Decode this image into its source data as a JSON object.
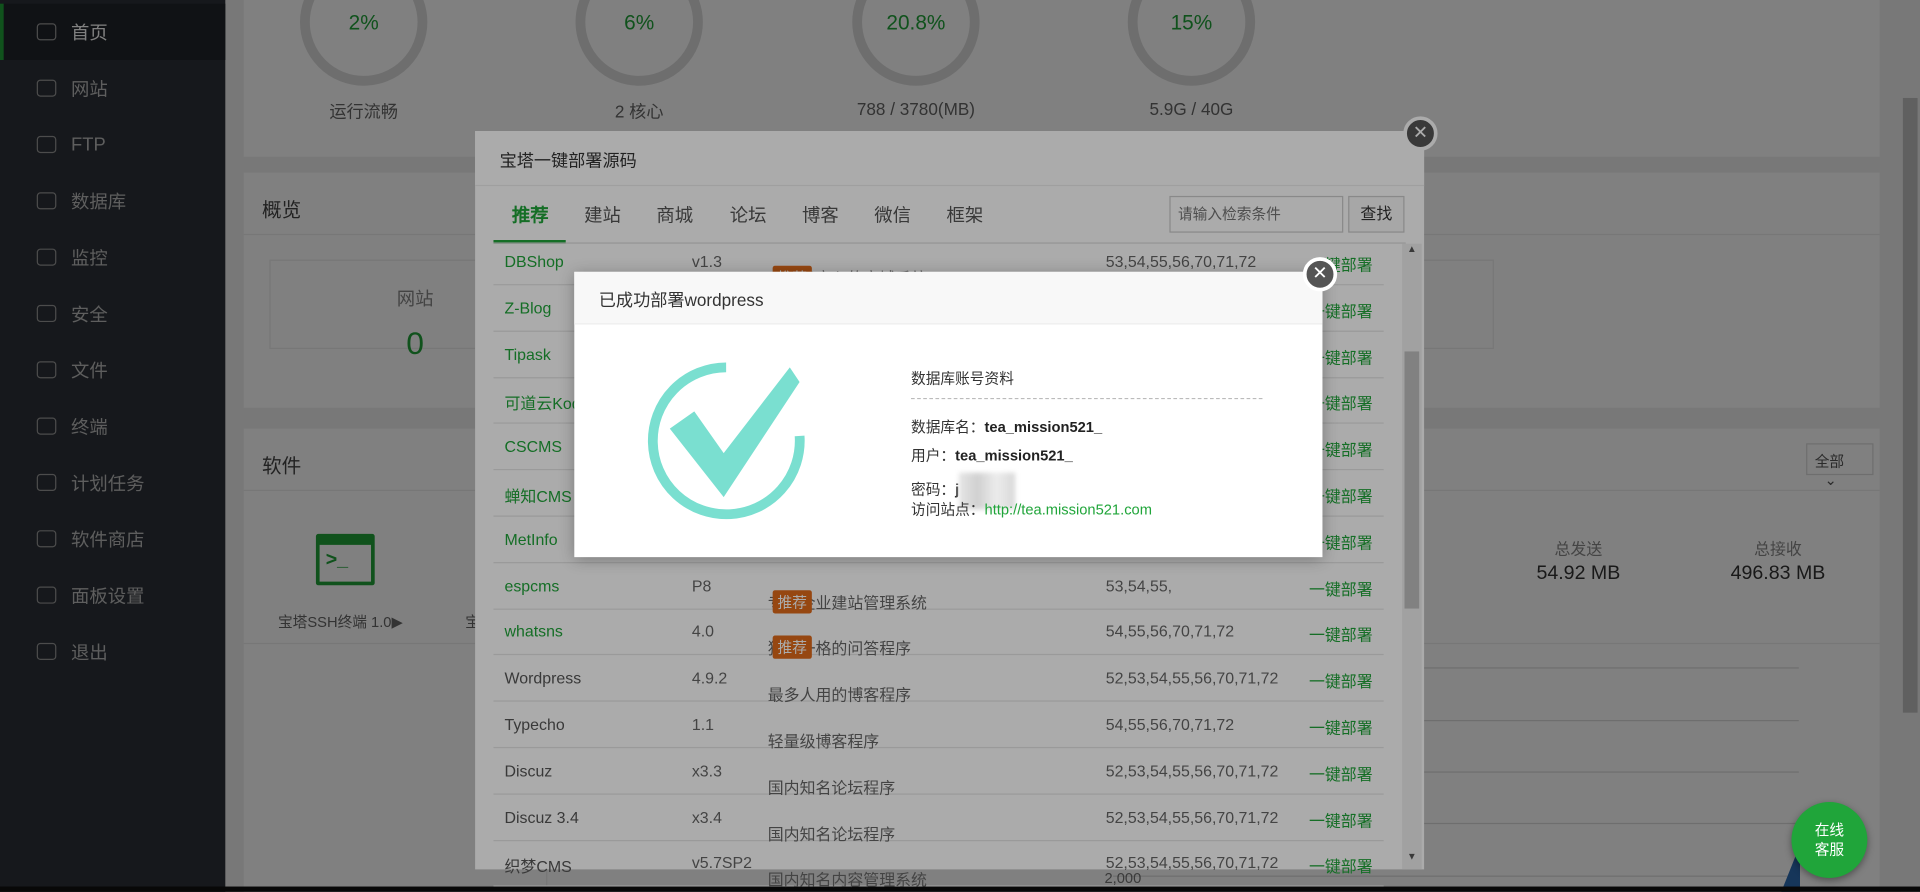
{
  "sidebar": {
    "items": [
      {
        "label": "首页",
        "icon": "home-icon"
      },
      {
        "label": "网站",
        "icon": "globe-icon"
      },
      {
        "label": "FTP",
        "icon": "ftp-icon"
      },
      {
        "label": "数据库",
        "icon": "database-icon"
      },
      {
        "label": "监控",
        "icon": "monitor-icon"
      },
      {
        "label": "安全",
        "icon": "shield-icon"
      },
      {
        "label": "文件",
        "icon": "folder-icon"
      },
      {
        "label": "终端",
        "icon": "terminal-icon"
      },
      {
        "label": "计划任务",
        "icon": "calendar-icon"
      },
      {
        "label": "软件商店",
        "icon": "grid-icon"
      },
      {
        "label": "面板设置",
        "icon": "gear-icon"
      },
      {
        "label": "退出",
        "icon": "logout-icon"
      }
    ]
  },
  "status": [
    {
      "value": "2%",
      "label": "运行流畅",
      "percent": 2
    },
    {
      "value": "6%",
      "label": "2 核心",
      "percent": 6
    },
    {
      "value": "20.8%",
      "label": "788 / 3780(MB)",
      "percent": 20.8
    },
    {
      "value": "15%",
      "label": "5.9G / 40G",
      "percent": 15
    }
  ],
  "overview": {
    "title": "概览",
    "site_label": "网站",
    "site_count": "0"
  },
  "software": {
    "title": "软件",
    "filter": "全部",
    "item_label": "宝塔SSH终端 1.0▶",
    "partial_label": "宝"
  },
  "traffic": {
    "sent_label": "总发送",
    "sent": "54.92 MB",
    "recv_label": "总接收",
    "recv": "496.83 MB",
    "axis_label": "2,000"
  },
  "deploy_dialog": {
    "title": "宝塔一键部署源码",
    "tabs": [
      "推荐",
      "建站",
      "商城",
      "论坛",
      "博客",
      "微信",
      "框架"
    ],
    "search_placeholder": "请输入检索条件",
    "search_button": "查找",
    "badge": "推荐",
    "action": "一键部署",
    "rows": [
      {
        "name": "DBShop",
        "version": "v1.3",
        "desc": "专业且良心的商城系统",
        "badge": true,
        "php": "53,54,55,56,70,71,72",
        "green": true
      },
      {
        "name": "Z-Blog",
        "version": "",
        "desc": "",
        "badge": false,
        "php": "",
        "green": true
      },
      {
        "name": "Tipask",
        "version": "",
        "desc": "",
        "badge": false,
        "php": "",
        "green": true
      },
      {
        "name": "可道云Kod",
        "version": "",
        "desc": "",
        "badge": false,
        "php": "",
        "green": true
      },
      {
        "name": "CSCMS",
        "version": "",
        "desc": "",
        "badge": false,
        "php": "",
        "green": true
      },
      {
        "name": "蝉知CMS",
        "version": "",
        "desc": "",
        "badge": false,
        "php": "",
        "green": true
      },
      {
        "name": "MetInfo",
        "version": "",
        "desc": "",
        "badge": false,
        "php": "",
        "green": true
      },
      {
        "name": "espcms",
        "version": "P8",
        "desc": "专业企业建站管理系统",
        "badge": true,
        "php": "53,54,55,",
        "green": true
      },
      {
        "name": "whatsns",
        "version": "4.0",
        "desc": "独具一格的问答程序",
        "badge": true,
        "php": "54,55,56,70,71,72",
        "green": true
      },
      {
        "name": "Wordpress",
        "version": "4.9.2",
        "desc": "最多人用的博客程序",
        "badge": false,
        "php": "52,53,54,55,56,70,71,72",
        "green": false
      },
      {
        "name": "Typecho",
        "version": "1.1",
        "desc": "轻量级博客程序",
        "badge": false,
        "php": "54,55,56,70,71,72",
        "green": false
      },
      {
        "name": "Discuz",
        "version": "x3.3",
        "desc": "国内知名论坛程序",
        "badge": false,
        "php": "52,53,54,55,56,70,71,72",
        "green": false
      },
      {
        "name": "Discuz 3.4",
        "version": "x3.4",
        "desc": "国内知名论坛程序",
        "badge": false,
        "php": "52,53,54,55,56,70,71,72",
        "green": false
      },
      {
        "name": "织梦CMS",
        "version": "v5.7SP2",
        "desc": "国内知名内容管理系统",
        "badge": false,
        "php": "52,53,54,55,56,70,71,72",
        "green": false
      }
    ]
  },
  "success_modal": {
    "title": "已成功部署wordpress",
    "section": "数据库账号资料",
    "db_label": "数据库名：",
    "db_value": "tea_mission521_",
    "user_label": "用户：",
    "user_value": "tea_mission521_",
    "pwd_label": "密码：",
    "pwd_value": "j",
    "site_label": "访问站点：",
    "site_value": "http://tea.mission521.com"
  },
  "support": {
    "line1": "在线",
    "line2": "客服"
  },
  "colors": {
    "accent": "#20a53a",
    "badge": "#e06a1a",
    "check": "#7adfd0"
  }
}
